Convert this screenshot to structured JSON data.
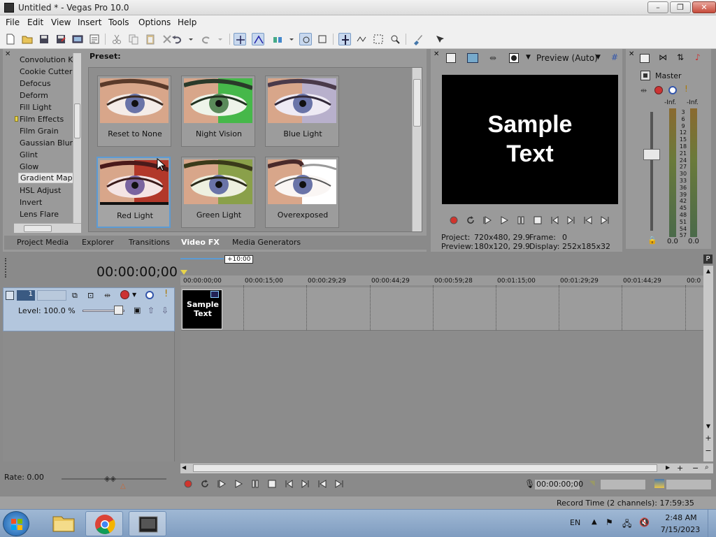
{
  "window": {
    "title": "Untitled * - Vegas Pro 10.0",
    "min": "–",
    "max": "❐",
    "close": "✕"
  },
  "menu": [
    "File",
    "Edit",
    "View",
    "Insert",
    "Tools",
    "Options",
    "Help"
  ],
  "fx": {
    "list": [
      "Convolution Ke",
      "Cookie Cutter",
      "Defocus",
      "Deform",
      "Fill Light",
      "Film Effects",
      "Film Grain",
      "Gaussian Blur",
      "Glint",
      "Glow",
      "Gradient Map",
      "HSL Adjust",
      "Invert",
      "Lens Flare"
    ],
    "selected_index": 10,
    "preset_label": "Preset:",
    "presets": [
      "Reset to None",
      "Night Vision",
      "Blue Light",
      "Red  Light",
      "Green  Light",
      "Overexposed"
    ],
    "selected_preset_index": 3
  },
  "tabs": [
    "Project Media",
    "Explorer",
    "Transitions",
    "Video FX",
    "Media Generators"
  ],
  "active_tab_index": 3,
  "preview": {
    "mode": "Preview (Auto)",
    "line1": "Sample",
    "line2": "Text",
    "project_label": "Project:",
    "project_value": "720x480, 29.9",
    "frame_label": "Frame:",
    "frame_value": "0",
    "preview_label": "Preview:",
    "preview_value": "180x120, 29.9",
    "display_label": "Display:",
    "display_value": "252x185x32"
  },
  "master": {
    "label": "Master",
    "left_inf": "-Inf.",
    "right_inf": "-Inf.",
    "scale": [
      "3",
      "6",
      "9",
      "12",
      "15",
      "18",
      "21",
      "24",
      "27",
      "30",
      "33",
      "36",
      "39",
      "42",
      "45",
      "48",
      "51",
      "54",
      "57"
    ],
    "left_value": "0.0",
    "right_value": "0.0"
  },
  "timeline": {
    "timecode": "00:00:00;00",
    "zoom_label": "+10:00",
    "ticks": [
      "00:00:00;00",
      "00:00:15;00",
      "00:00:29;29",
      "00:00:44;29",
      "00:00:59;28",
      "00:01:15;00",
      "00:01:29;29",
      "00:01:44;29",
      "00:0"
    ],
    "track_number": "1",
    "level": "Level: 100.0 %",
    "clip_text": "Sample Text",
    "rate": "Rate: 0.00",
    "cursor_time": "00:00:00;00",
    "record_time": "Record Time (2 channels): 17:59:35"
  },
  "taskbar": {
    "lang": "EN",
    "time": "2:48 AM",
    "date": "7/15/2023"
  },
  "colors": {
    "accent": "#5b9bd5",
    "track": "#b3c6dd",
    "record": "#d0342c"
  }
}
